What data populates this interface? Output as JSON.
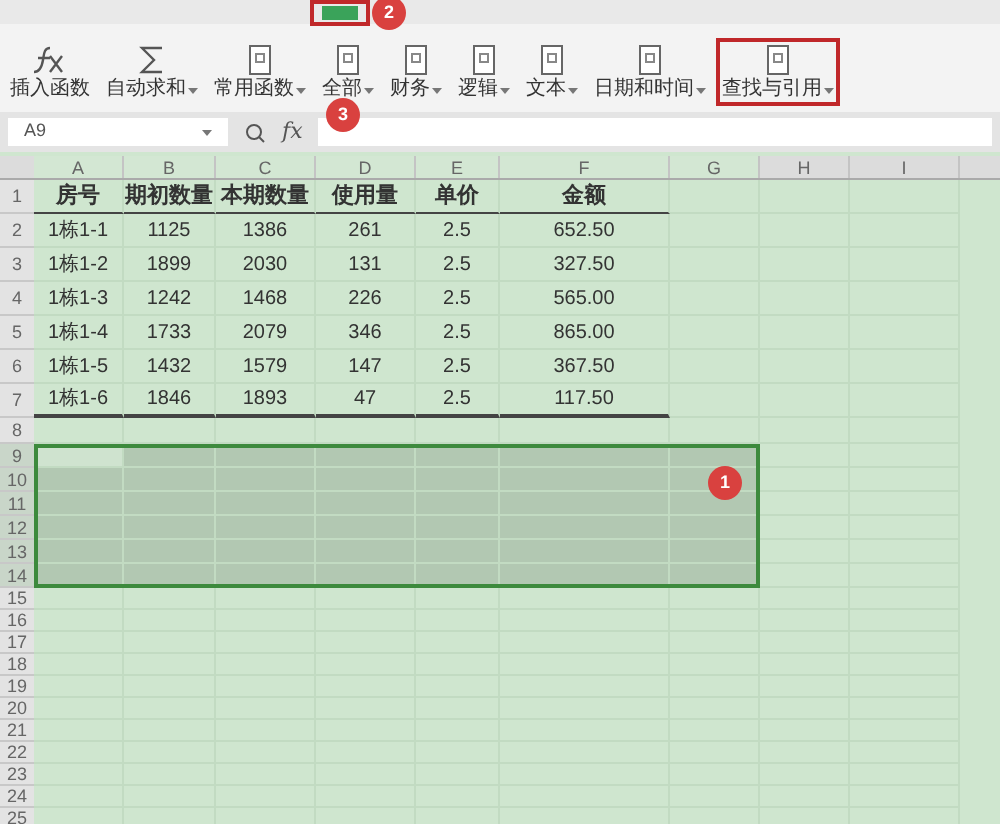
{
  "ribbon": {
    "tools": [
      {
        "label": "插入函数",
        "dropdown": false,
        "highlighted": false
      },
      {
        "label": "自动求和",
        "dropdown": true,
        "highlighted": false
      },
      {
        "label": "常用函数",
        "dropdown": true,
        "highlighted": false
      },
      {
        "label": "全部",
        "dropdown": true,
        "highlighted": false
      },
      {
        "label": "财务",
        "dropdown": true,
        "highlighted": false
      },
      {
        "label": "逻辑",
        "dropdown": true,
        "highlighted": false
      },
      {
        "label": "文本",
        "dropdown": true,
        "highlighted": false
      },
      {
        "label": "日期和时间",
        "dropdown": true,
        "highlighted": false
      },
      {
        "label": "查找与引用",
        "dropdown": true,
        "highlighted": true
      }
    ]
  },
  "formula_bar": {
    "name_box": "A9",
    "fx": "fx"
  },
  "sheet": {
    "columns": [
      "A",
      "B",
      "C",
      "D",
      "E",
      "F",
      "G",
      "H",
      "I"
    ],
    "rows": [
      {
        "number": "1",
        "selected": false,
        "cells": [
          "房号",
          "期初数量",
          "本期数量",
          "使用量",
          "单价",
          "金额"
        ]
      },
      {
        "number": "2",
        "selected": false,
        "cells": [
          "1栋1-1",
          "1125",
          "1386",
          "261",
          "2.5",
          "652.50"
        ]
      },
      {
        "number": "3",
        "selected": false,
        "cells": [
          "1栋1-2",
          "1899",
          "2030",
          "131",
          "2.5",
          "327.50"
        ]
      },
      {
        "number": "4",
        "selected": false,
        "cells": [
          "1栋1-3",
          "1242",
          "1468",
          "226",
          "2.5",
          "565.00"
        ]
      },
      {
        "number": "5",
        "selected": false,
        "cells": [
          "1栋1-4",
          "1733",
          "2079",
          "346",
          "2.5",
          "865.00"
        ]
      },
      {
        "number": "6",
        "selected": false,
        "cells": [
          "1栋1-5",
          "1432",
          "1579",
          "147",
          "2.5",
          "367.50"
        ]
      },
      {
        "number": "7",
        "selected": false,
        "cells": [
          "1栋1-6",
          "1846",
          "1893",
          "47",
          "2.5",
          "117.50"
        ]
      },
      {
        "number": "8",
        "selected": false
      },
      {
        "number": "9",
        "selected": true
      },
      {
        "number": "10",
        "selected": true
      },
      {
        "number": "11",
        "selected": true
      },
      {
        "number": "12",
        "selected": true
      },
      {
        "number": "13",
        "selected": true
      },
      {
        "number": "14",
        "selected": true
      },
      {
        "number": "15",
        "selected": false
      },
      {
        "number": "16",
        "selected": false
      },
      {
        "number": "17",
        "selected": false
      },
      {
        "number": "18",
        "selected": false
      },
      {
        "number": "19",
        "selected": false
      },
      {
        "number": "20",
        "selected": false
      },
      {
        "number": "21",
        "selected": false
      },
      {
        "number": "22",
        "selected": false
      },
      {
        "number": "23",
        "selected": false
      },
      {
        "number": "24",
        "selected": false
      },
      {
        "number": "25",
        "selected": false
      }
    ]
  },
  "step_markers": [
    {
      "label": "1"
    },
    {
      "label": "2"
    },
    {
      "label": "3"
    }
  ]
}
